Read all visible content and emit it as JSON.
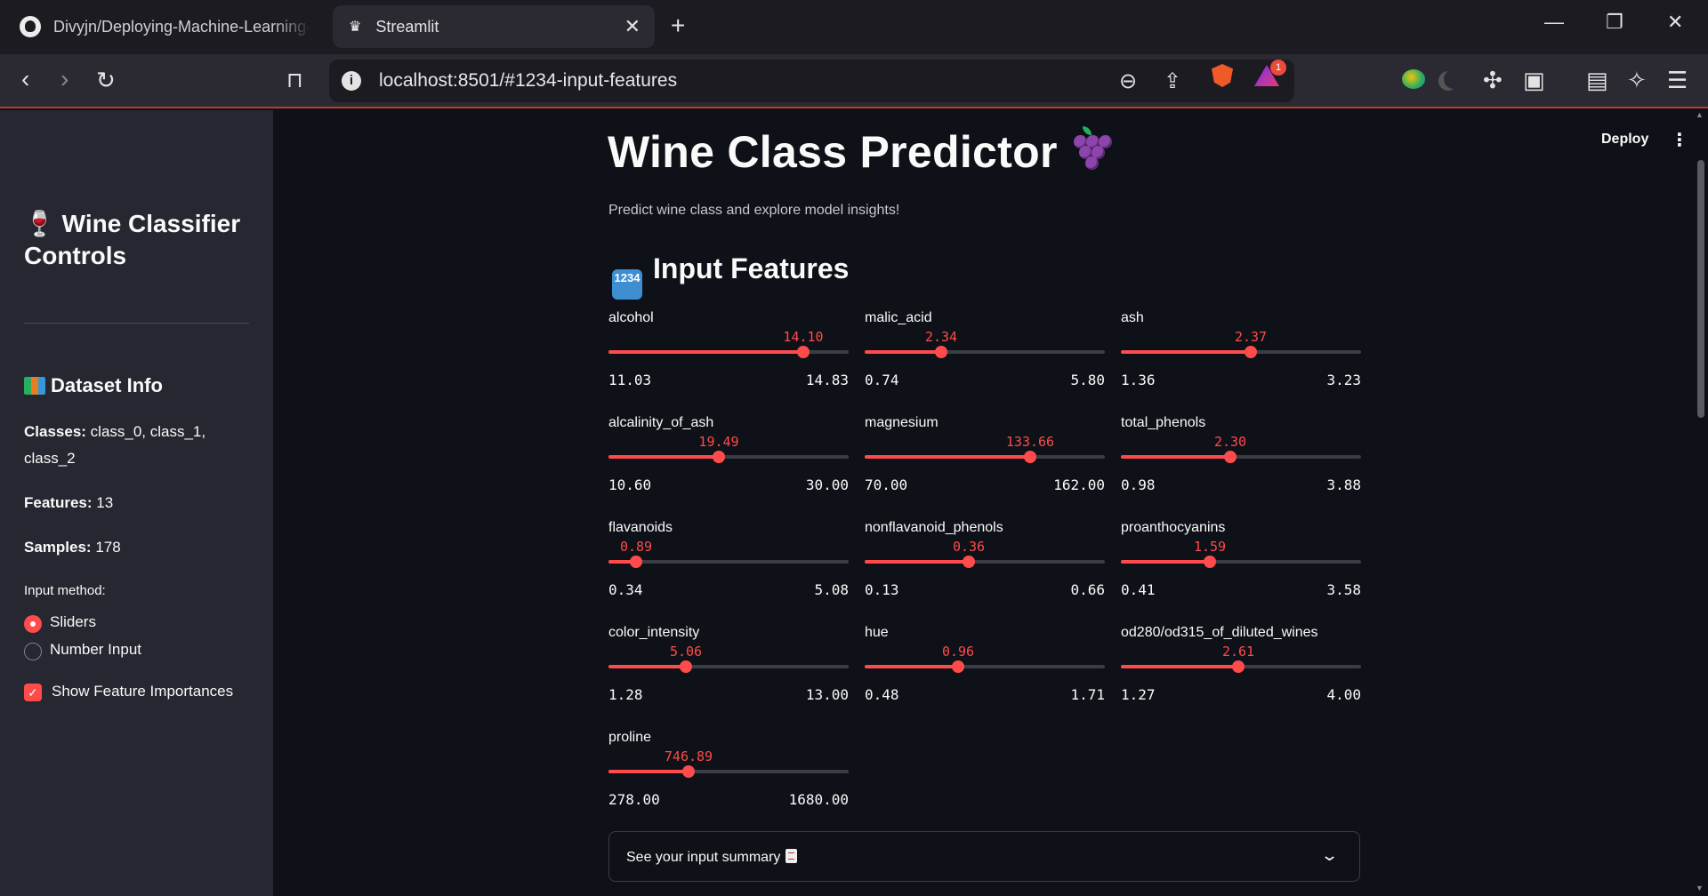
{
  "browser": {
    "tabs": [
      {
        "title": "Divyjn/Deploying-Machine-Learning-"
      },
      {
        "title": "Streamlit"
      }
    ],
    "url": "localhost:8501/#1234-input-features",
    "rewards_badge": "1"
  },
  "header": {
    "deploy_label": "Deploy"
  },
  "sidebar": {
    "title": "🍷 Wine Classifier Controls",
    "dataset_heading": "Dataset Info",
    "classes_label": "Classes:",
    "classes_value": " class_0, class_1, class_2",
    "features_label": "Features:",
    "features_value": " 13",
    "samples_label": "Samples:",
    "samples_value": " 178",
    "input_method_label": "Input method:",
    "input_options": [
      "Sliders",
      "Number Input"
    ],
    "selected_input": "Sliders",
    "show_importances_label": "Show Feature Importances",
    "show_importances_checked": true
  },
  "main": {
    "title": "Wine Class Predictor",
    "subtitle": "Predict wine class and explore model insights!",
    "section_heading": "Input Features",
    "section_icon_text": "1234",
    "sliders": [
      {
        "label": "alcohol",
        "value": "14.10",
        "min": "11.03",
        "max": "14.83",
        "fraction": 0.81
      },
      {
        "label": "malic_acid",
        "value": "2.34",
        "min": "0.74",
        "max": "5.80",
        "fraction": 0.32
      },
      {
        "label": "ash",
        "value": "2.37",
        "min": "1.36",
        "max": "3.23",
        "fraction": 0.54
      },
      {
        "label": "alcalinity_of_ash",
        "value": "19.49",
        "min": "10.60",
        "max": "30.00",
        "fraction": 0.46
      },
      {
        "label": "magnesium",
        "value": "133.66",
        "min": "70.00",
        "max": "162.00",
        "fraction": 0.69
      },
      {
        "label": "total_phenols",
        "value": "2.30",
        "min": "0.98",
        "max": "3.88",
        "fraction": 0.455
      },
      {
        "label": "flavanoids",
        "value": "0.89",
        "min": "0.34",
        "max": "5.08",
        "fraction": 0.116
      },
      {
        "label": "nonflavanoid_phenols",
        "value": "0.36",
        "min": "0.13",
        "max": "0.66",
        "fraction": 0.434
      },
      {
        "label": "proanthocyanins",
        "value": "1.59",
        "min": "0.41",
        "max": "3.58",
        "fraction": 0.372
      },
      {
        "label": "color_intensity",
        "value": "5.06",
        "min": "1.28",
        "max": "13.00",
        "fraction": 0.322
      },
      {
        "label": "hue",
        "value": "0.96",
        "min": "0.48",
        "max": "1.71",
        "fraction": 0.39
      },
      {
        "label": "od280/od315_of_diluted_wines",
        "value": "2.61",
        "min": "1.27",
        "max": "4.00",
        "fraction": 0.49
      },
      {
        "label": "proline",
        "value": "746.89",
        "min": "278.00",
        "max": "1680.00",
        "fraction": 0.334
      }
    ],
    "expander_label": "See your input summary"
  },
  "colors": {
    "accent": "#ff4b4b",
    "background": "#0e1117",
    "sidebar": "#262730"
  },
  "icons": [
    "github-icon",
    "streamlit-crown-icon",
    "close-icon",
    "plus-icon",
    "back-icon",
    "forward-icon",
    "reload-icon",
    "bookmark-icon",
    "info-icon",
    "zoom-out-icon",
    "share-icon",
    "brave-shield-icon",
    "rewards-icon",
    "extensions-icon",
    "wallet-icon",
    "menu-icon",
    "grapes-icon",
    "wine-glass-icon",
    "books-icon",
    "document-icon",
    "chevron-down-icon"
  ]
}
